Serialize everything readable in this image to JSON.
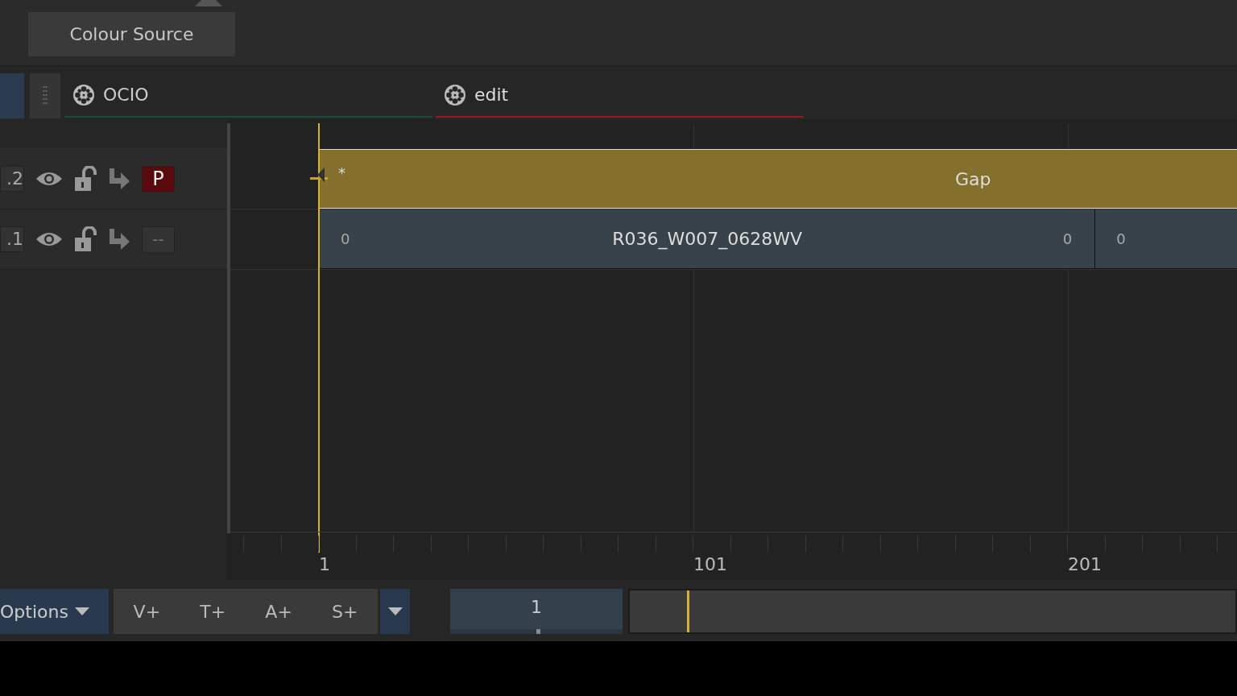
{
  "toolbar": {
    "button": "Colour Source"
  },
  "tabs": [
    {
      "label": "OCIO",
      "selected": false,
      "color": "#1f4a3a"
    },
    {
      "label": "edit",
      "selected": true,
      "color": "#8a1c22"
    }
  ],
  "tracks": [
    {
      "label": ".2",
      "visible": true,
      "locked": false,
      "target": "P",
      "target_on": true,
      "clips": [
        {
          "kind": "gap",
          "label": "Gap",
          "marker": "*"
        }
      ]
    },
    {
      "label": ".1",
      "visible": true,
      "locked": false,
      "target": "--",
      "target_on": false,
      "clips": [
        {
          "kind": "media",
          "label": "R036_W007_0628WV",
          "in": "0",
          "out": "0"
        },
        {
          "kind": "media",
          "in": "0"
        }
      ]
    }
  ],
  "ruler": {
    "labels": [
      "1",
      "101",
      "201"
    ]
  },
  "bottom_bar": {
    "options": "Options",
    "add_buttons": [
      "V+",
      "T+",
      "A+",
      "S+"
    ],
    "frame": {
      "value": "1",
      "level": 0.5
    },
    "scrubber": {
      "level": 0.094
    }
  }
}
